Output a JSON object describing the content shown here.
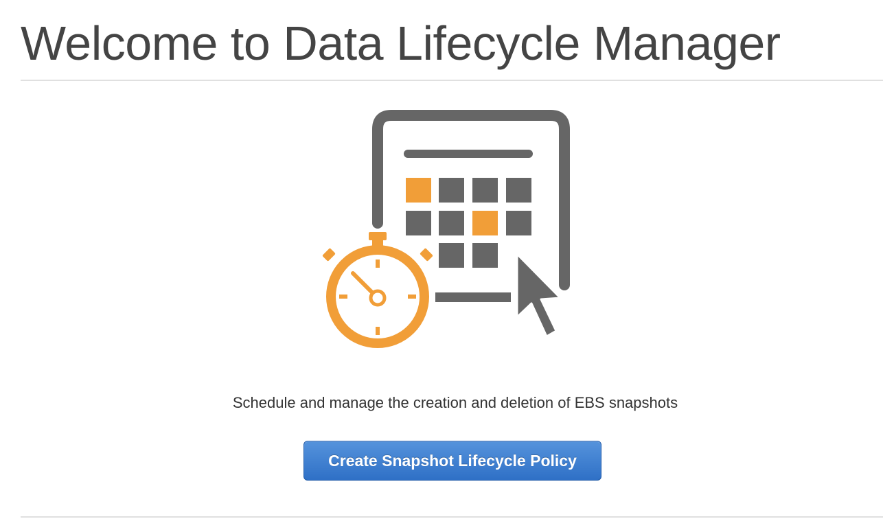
{
  "header": {
    "title": "Welcome to Data Lifecycle Manager"
  },
  "hero": {
    "icon": "calendar-stopwatch-cursor-icon",
    "colors": {
      "gray": "#666666",
      "orange": "#f19e38"
    }
  },
  "main": {
    "description": "Schedule and manage the creation and deletion of EBS snapshots",
    "create_button_label": "Create Snapshot Lifecycle Policy"
  },
  "colors": {
    "button": "#3a7bd0",
    "title_text": "#444444"
  }
}
